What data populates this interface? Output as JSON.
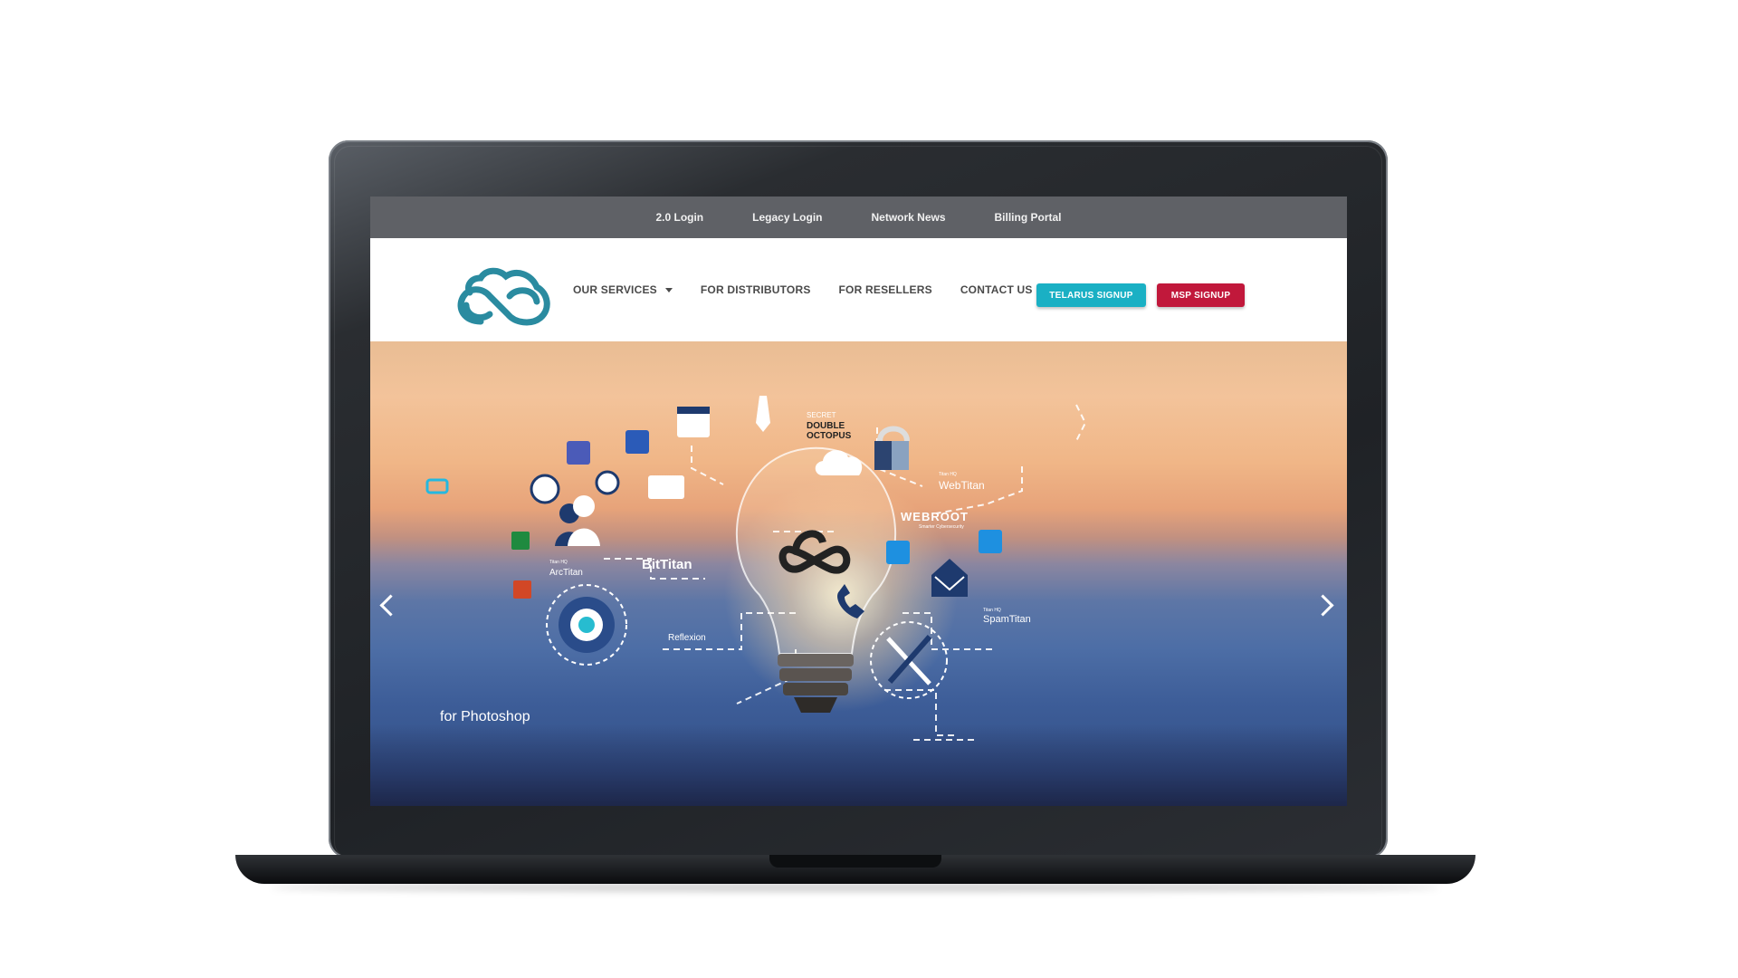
{
  "topbar": {
    "links": [
      "2.0 Login",
      "Legacy Login",
      "Network News",
      "Billing Portal"
    ]
  },
  "nav": {
    "menu": [
      "OUR SERVICES",
      "FOR DISTRIBUTORS",
      "FOR RESELLERS",
      "CONTACT US"
    ],
    "telarus_button": "TELARUS SIGNUP",
    "msp_button": "MSP SIGNUP"
  },
  "hero": {
    "caption": "for Photoshop",
    "logos": {
      "secret_double_octopus_line1": "SECRET",
      "secret_double_octopus_line2": "DOUBLE",
      "secret_double_octopus_line3": "OCTOPUS",
      "webtitan_small": "Titan HQ",
      "webtitan": "WebTitan",
      "webroot": "WEBROOT",
      "webroot_sub": "Smarter Cybersecurity",
      "bittitan": "BitTitan",
      "arctitan_small": "Titan HQ",
      "arctitan": "ArcTitan",
      "spamtitan_small": "Titan HQ",
      "spamtitan": "SpamTitan",
      "reflexion": "Reflexion"
    }
  },
  "colors": {
    "topbar": "#5f6166",
    "brand_teal": "#2a8ba0",
    "telarus": "#1ab0c4",
    "msp": "#c1183b"
  }
}
